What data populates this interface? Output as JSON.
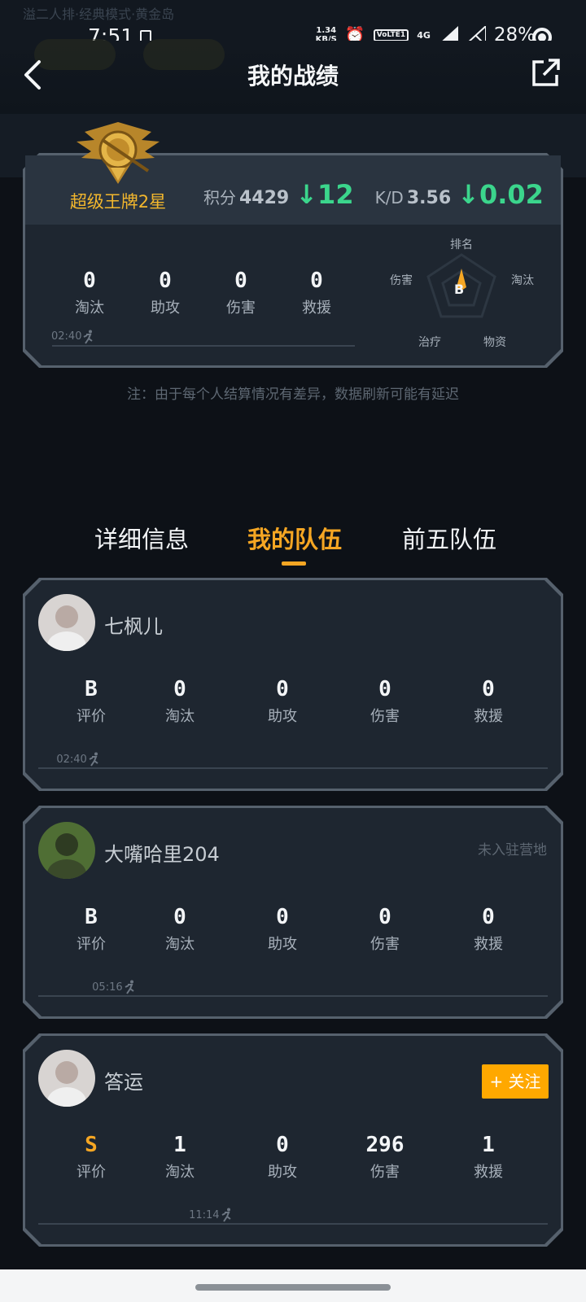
{
  "status_bar": {
    "time": "7:51",
    "net_speed_value": "1.34",
    "net_speed_unit": "KB/S",
    "volte_label": "VoLTE1",
    "network_label": "4G",
    "battery": "28%",
    "ghost_text": "溢二人排·经典模式·黄金岛"
  },
  "header": {
    "title": "我的战绩"
  },
  "summary": {
    "rank_name": "超级王牌2星",
    "score_label": "积分",
    "score": "4429",
    "score_delta": "12",
    "kd_label": "K/D",
    "kd": "3.56",
    "kd_delta": "0.02",
    "stats": [
      {
        "value": "0",
        "label": "淘汰"
      },
      {
        "value": "0",
        "label": "助攻"
      },
      {
        "value": "0",
        "label": "伤害"
      },
      {
        "value": "0",
        "label": "救援"
      }
    ],
    "survival_time": "02:40",
    "radar": {
      "grade": "B",
      "labels": {
        "top": "排名",
        "right": "淘汰",
        "bottom_right": "物资",
        "bottom_left": "治疗",
        "left": "伤害"
      }
    }
  },
  "note": "注：由于每个人结算情况有差异，数据刷新可能有延迟",
  "tabs": [
    {
      "label": "详细信息",
      "active": false
    },
    {
      "label": "我的队伍",
      "active": true
    },
    {
      "label": "前五队伍",
      "active": false
    }
  ],
  "team": [
    {
      "name": "七枫儿",
      "camp_status": "",
      "follow_label": "",
      "grade": "B",
      "grade_color": "#f3f5f7",
      "survival_time": "02:40",
      "survival_fraction": 0.09,
      "stats": [
        {
          "value": "B",
          "label": "评价"
        },
        {
          "value": "0",
          "label": "淘汰"
        },
        {
          "value": "0",
          "label": "助攻"
        },
        {
          "value": "0",
          "label": "伤害"
        },
        {
          "value": "0",
          "label": "救援"
        }
      ]
    },
    {
      "name": "大嘴哈里204",
      "camp_status": "未入驻营地",
      "follow_label": "",
      "grade": "B",
      "grade_color": "#f3f5f7",
      "survival_time": "05:16",
      "survival_fraction": 0.16,
      "stats": [
        {
          "value": "B",
          "label": "评价"
        },
        {
          "value": "0",
          "label": "淘汰"
        },
        {
          "value": "0",
          "label": "助攻"
        },
        {
          "value": "0",
          "label": "伤害"
        },
        {
          "value": "0",
          "label": "救援"
        }
      ]
    },
    {
      "name": "答运",
      "camp_status": "",
      "follow_label": "+ 关注",
      "grade": "S",
      "grade_color": "#f5a623",
      "survival_time": "11:14",
      "survival_fraction": 0.35,
      "stats": [
        {
          "value": "S",
          "label": "评价"
        },
        {
          "value": "1",
          "label": "淘汰"
        },
        {
          "value": "0",
          "label": "助攻"
        },
        {
          "value": "296",
          "label": "伤害"
        },
        {
          "value": "1",
          "label": "救援"
        }
      ]
    }
  ],
  "colors": {
    "accent": "#f5a623",
    "delta_green": "#3bd58c",
    "card_bg": "#1e2630"
  },
  "icons": [
    "back-arrow-icon",
    "share-icon",
    "runner-icon",
    "alarm-icon",
    "signal-icon",
    "battery-icon",
    "rank-emblem-icon"
  ]
}
